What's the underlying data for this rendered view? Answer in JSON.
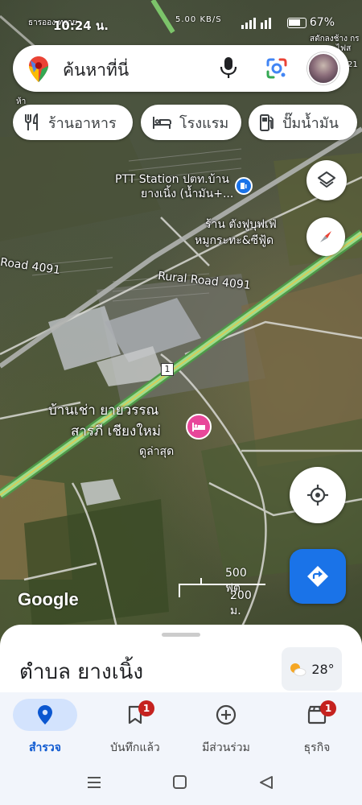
{
  "status_bar": {
    "time": "10:24 น.",
    "network_speed": "5.00 KB/S",
    "battery": "67%"
  },
  "search": {
    "placeholder": "ค้นหาที่นี่"
  },
  "chips": [
    {
      "label": "ร้านอาหาร",
      "icon": "restaurant-icon"
    },
    {
      "label": "โรงแรม",
      "icon": "hotel-icon"
    },
    {
      "label": "ปั๊มน้ำมัน",
      "icon": "gas-station-icon"
    }
  ],
  "map": {
    "labels": {
      "top_left": "ธารออง ทราย",
      "top_right": "สตักลงช้าง กร",
      "top_right2": "ไฟส",
      "ptt_line1": "PTT Station ปตท.บ้าน",
      "ptt_line2": "ยางเนิ้ง (น้ำมัน+...",
      "restaurant_line1": "ร้าน ตังฟูบุฟเฟ่",
      "restaurant_line2": "หมูกระทะ&ซีฟู้ด",
      "road_left": "Road 4091",
      "road_center": "Rural Road 4091",
      "road_shield": "1",
      "hotel_line1": "บ้านเช่า ยายวรรณ",
      "hotel_line2": "สารภี เชียงใหม่",
      "hotel_sub": "ดูล่าสุด",
      "small_tag": "ห้า",
      "edge_right": "21"
    },
    "scale_ft": "500 ฟุต",
    "scale_m": "200 ม.",
    "logo": "Google"
  },
  "sheet": {
    "title": "ตำบล ยางเนิ้ง",
    "weather": "28°"
  },
  "nav": [
    {
      "label": "สำรวจ",
      "icon": "explore-pin-icon",
      "active": true,
      "badge": ""
    },
    {
      "label": "บันทึกแล้ว",
      "icon": "saved-icon",
      "active": false,
      "badge": "1"
    },
    {
      "label": "มีส่วนร่วม",
      "icon": "contribute-icon",
      "active": false,
      "badge": ""
    },
    {
      "label": "ธุรกิจ",
      "icon": "business-icon",
      "active": false,
      "badge": "1"
    }
  ],
  "colors": {
    "accent": "#1a73e8",
    "badge": "#c5221f",
    "hotel_pin": "#e8479a",
    "highway": "#7cc46a"
  }
}
